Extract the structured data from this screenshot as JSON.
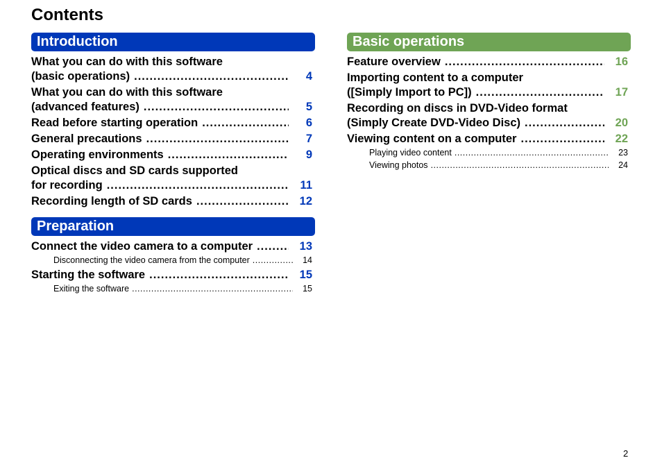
{
  "title": "Contents",
  "dots": "..............................................................................................................",
  "colors": {
    "introduction": "#0038b8",
    "basic_operations": "#6fa455"
  },
  "introduction": {
    "header": "Introduction",
    "entries": [
      {
        "line1": "What you can do with this software",
        "label": "(basic operations)",
        "page": "4"
      },
      {
        "line1": "What you can do with this software",
        "label": "(advanced features)",
        "page": "5"
      },
      {
        "label": "Read before starting operation",
        "page": "6"
      },
      {
        "label": "General precautions",
        "page": "7"
      },
      {
        "label": "Operating environments",
        "page": "9"
      },
      {
        "line1": "Optical discs and SD cards supported",
        "label": "for recording",
        "page": "11"
      },
      {
        "label": "Recording length of SD cards",
        "page": "12"
      }
    ]
  },
  "preparation": {
    "header": "Preparation",
    "entries": [
      {
        "label": "Connect the video camera to a computer",
        "page": "13",
        "sub": [
          {
            "label": "Disconnecting the video camera from the computer",
            "page": "14"
          }
        ]
      },
      {
        "label": "Starting the software",
        "page": "15",
        "sub": [
          {
            "label": "Exiting the software",
            "page": "15"
          }
        ]
      }
    ]
  },
  "basic_operations": {
    "header": "Basic operations",
    "entries": [
      {
        "label": "Feature overview",
        "page": "16"
      },
      {
        "line1": "Importing content to a computer",
        "label": "([Simply Import to PC])",
        "page": "17"
      },
      {
        "line1": "Recording on discs in DVD-Video format",
        "label": "(Simply Create DVD-Video Disc)",
        "page": "20"
      },
      {
        "label": "Viewing content on a computer",
        "page": "22",
        "sub": [
          {
            "label": "Playing video content",
            "page": "23"
          },
          {
            "label": "Viewing photos",
            "page": "24"
          }
        ]
      }
    ]
  },
  "page_number": "2"
}
